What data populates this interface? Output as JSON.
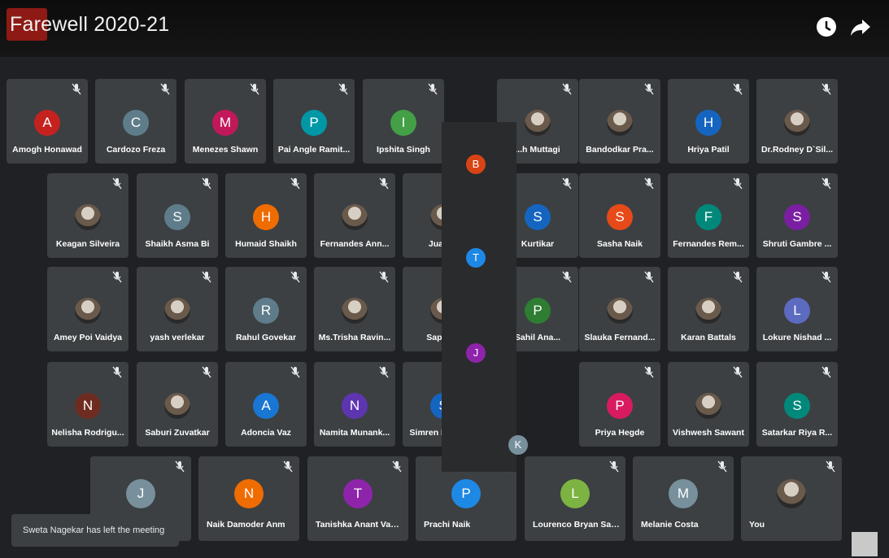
{
  "meeting": {
    "title": "Farewell 2020-21"
  },
  "toast": {
    "message": "Sweta Nagekar has left the meeting"
  },
  "participants": [
    {
      "name": "Amogh Honawad",
      "initial": "A",
      "color": "#c5221f"
    },
    {
      "name": "Cardozo Freza",
      "initial": "C",
      "color": "#5f7c8a"
    },
    {
      "name": "Menezes Shawn",
      "initial": "M",
      "color": "#c2185b"
    },
    {
      "name": "Pai Angle Ramit...",
      "initial": "P",
      "color": "#0097a7"
    },
    {
      "name": "Ipshita Singh",
      "initial": "I",
      "color": "#43a047"
    },
    {
      "name": "...h Muttagi",
      "initial": "",
      "color": "#9e9e9e",
      "photo": true
    },
    {
      "name": "Bandodkar Pra...",
      "initial": "",
      "color": "#6d4c41",
      "photo": true
    },
    {
      "name": "Hriya Patil",
      "initial": "H",
      "color": "#1565c0"
    },
    {
      "name": "Dr.Rodney D`Sil...",
      "initial": "",
      "color": "#8d6e63",
      "photo": true
    },
    {
      "name": "Keagan Silveira",
      "initial": "",
      "color": "#bdbdbd",
      "photo": true
    },
    {
      "name": "Shaikh Asma Bi",
      "initial": "S",
      "color": "#5f7c8a"
    },
    {
      "name": "Humaid Shaikh",
      "initial": "H",
      "color": "#ef6c00"
    },
    {
      "name": "Fernandes Ann...",
      "initial": "",
      "color": "#a1887f",
      "photo": true
    },
    {
      "name": "Juanv /",
      "initial": "",
      "color": "#424242",
      "photo": true
    },
    {
      "name": "Kurtikar",
      "initial": "S",
      "color": "#1565c0"
    },
    {
      "name": "Sasha Naik",
      "initial": "S",
      "color": "#e64a19"
    },
    {
      "name": "Fernandes Rem...",
      "initial": "F",
      "color": "#00897b"
    },
    {
      "name": "Shruti Gambre ...",
      "initial": "S",
      "color": "#7b1fa2"
    },
    {
      "name": "Amey Poi Vaidya",
      "initial": "",
      "color": "#b71c1c",
      "photo": true
    },
    {
      "name": "yash verlekar",
      "initial": "",
      "color": "#8d6e63",
      "photo": true
    },
    {
      "name": "Rahul Govekar",
      "initial": "R",
      "color": "#5f7c8a"
    },
    {
      "name": "Ms.Trisha Ravin...",
      "initial": "",
      "color": "#4db6ac",
      "photo": true
    },
    {
      "name": "Sapresh",
      "initial": "",
      "color": "#fdd835",
      "photo": true
    },
    {
      "name": "Sahil Ana...",
      "initial": "P",
      "color": "#2e7d32"
    },
    {
      "name": "Slauka Fernand...",
      "initial": "",
      "color": "#111111",
      "photo": true
    },
    {
      "name": "Karan Battals",
      "initial": "",
      "color": "#a1887f",
      "photo": true
    },
    {
      "name": "Lokure Nishad ...",
      "initial": "L",
      "color": "#5c6bc0"
    },
    {
      "name": "Nelisha Rodrigu...",
      "initial": "N",
      "color": "#6d2c1f"
    },
    {
      "name": "Saburi Zuvatkar",
      "initial": "",
      "color": "#424242",
      "photo": true
    },
    {
      "name": "Adoncia Vaz",
      "initial": "A",
      "color": "#1976d2"
    },
    {
      "name": "Namita Munank...",
      "initial": "N",
      "color": "#5e35b1"
    },
    {
      "name": "Simren Mascar...",
      "initial": "S",
      "color": "#1565c0"
    },
    {
      "name": "Priya Hegde",
      "initial": "P",
      "color": "#d81b60"
    },
    {
      "name": "Vishwesh Sawant",
      "initial": "",
      "color": "#111111",
      "photo": true
    },
    {
      "name": "Satarkar Riya R...",
      "initial": "S",
      "color": "#00897b"
    },
    {
      "name": "",
      "initial": "J",
      "color": "#78909c"
    },
    {
      "name": "Naik Damoder Anm",
      "initial": "N",
      "color": "#ef6c00"
    },
    {
      "name": "Tanishka Anant Vam...",
      "initial": "T",
      "color": "#8e24aa"
    },
    {
      "name": "Prachi Naik",
      "initial": "P",
      "color": "#1e88e5"
    },
    {
      "name": "Lourenco Bryan Savic",
      "initial": "L",
      "color": "#7cb342"
    },
    {
      "name": "Melanie Costa",
      "initial": "M",
      "color": "#78909c"
    },
    {
      "name": "You",
      "initial": "",
      "color": "#e0e0e0",
      "photo": true
    }
  ],
  "glitch_overlay": [
    "B",
    "T",
    "J",
    "K"
  ]
}
